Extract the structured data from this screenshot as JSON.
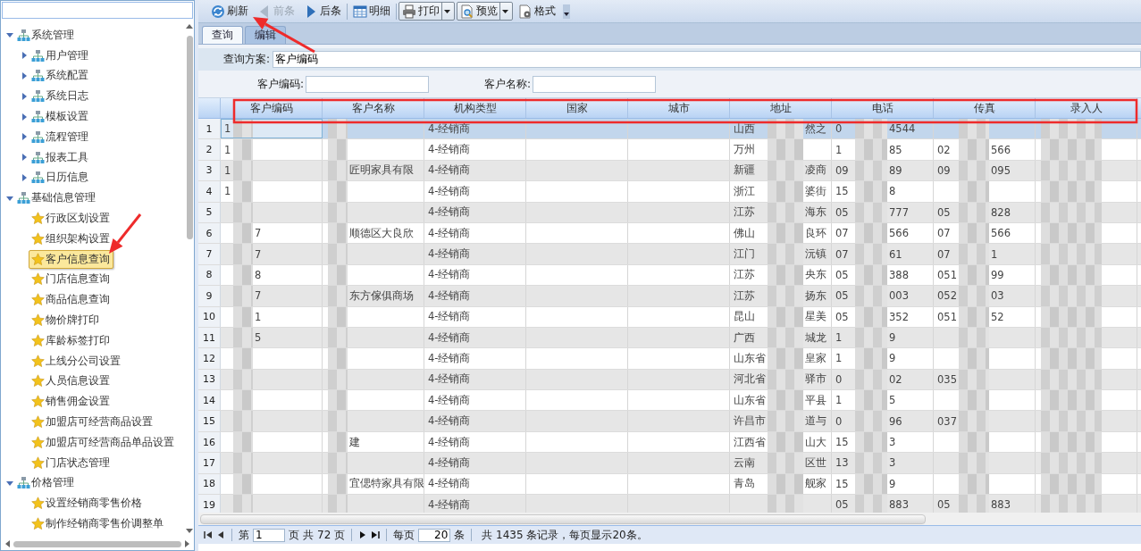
{
  "sidebar": {
    "tree": [
      {
        "label": "系统管理",
        "kind": "group",
        "expanded": true,
        "selected": false,
        "children": [
          {
            "label": "用户管理",
            "kind": "group",
            "expanded": false,
            "selected": false
          },
          {
            "label": "系统配置",
            "kind": "group",
            "expanded": false,
            "selected": false
          },
          {
            "label": "系统日志",
            "kind": "group",
            "expanded": false,
            "selected": false
          },
          {
            "label": "模板设置",
            "kind": "group",
            "expanded": false,
            "selected": false
          },
          {
            "label": "流程管理",
            "kind": "group",
            "expanded": false,
            "selected": false
          },
          {
            "label": "报表工具",
            "kind": "group",
            "expanded": false,
            "selected": false
          },
          {
            "label": "日历信息",
            "kind": "group",
            "expanded": false,
            "selected": false
          }
        ]
      },
      {
        "label": "基础信息管理",
        "kind": "group",
        "expanded": true,
        "selected": false,
        "children": [
          {
            "label": "行政区划设置",
            "kind": "leaf",
            "selected": false
          },
          {
            "label": "组织架构设置",
            "kind": "leaf",
            "selected": false
          },
          {
            "label": "客户信息查询",
            "kind": "leaf",
            "selected": true
          },
          {
            "label": "门店信息查询",
            "kind": "leaf",
            "selected": false
          },
          {
            "label": "商品信息查询",
            "kind": "leaf",
            "selected": false
          },
          {
            "label": "物价牌打印",
            "kind": "leaf",
            "selected": false
          },
          {
            "label": "库龄标签打印",
            "kind": "leaf",
            "selected": false
          },
          {
            "label": "上线分公司设置",
            "kind": "leaf",
            "selected": false
          },
          {
            "label": "人员信息设置",
            "kind": "leaf",
            "selected": false
          },
          {
            "label": "销售佣金设置",
            "kind": "leaf",
            "selected": false
          },
          {
            "label": "加盟店可经营商品设置",
            "kind": "leaf",
            "selected": false
          },
          {
            "label": "加盟店可经营商品单品设置",
            "kind": "leaf",
            "selected": false
          },
          {
            "label": "门店状态管理",
            "kind": "leaf",
            "selected": false
          }
        ]
      },
      {
        "label": "价格管理",
        "kind": "group",
        "expanded": true,
        "selected": false,
        "children": [
          {
            "label": "设置经销商零售价格",
            "kind": "leaf",
            "selected": false
          },
          {
            "label": "制作经销商零售价调整单",
            "kind": "leaf",
            "selected": false
          }
        ]
      }
    ]
  },
  "toolbar": [
    {
      "label": "刷新",
      "kind": "button",
      "disabled": false
    },
    {
      "label": "前条",
      "kind": "button",
      "disabled": true
    },
    {
      "label": "后条",
      "kind": "button",
      "disabled": false
    },
    {
      "label": "明细",
      "kind": "button",
      "disabled": false
    },
    {
      "label": "打印",
      "kind": "split",
      "disabled": false
    },
    {
      "label": "预览",
      "kind": "split",
      "disabled": false
    },
    {
      "label": "格式",
      "kind": "button",
      "disabled": false
    }
  ],
  "tabs": [
    {
      "label": "查询",
      "selected": true
    },
    {
      "label": "编辑",
      "selected": false
    }
  ],
  "query_scheme": {
    "label": "查询方案:",
    "value": "客户编码"
  },
  "filters": [
    {
      "label": "客户编码:"
    },
    {
      "label": "客户名称:"
    }
  ],
  "table": {
    "columns": [
      {
        "label": "客户编码",
        "redacted": true
      },
      {
        "label": "客户名称",
        "redacted": true
      },
      {
        "label": "机构类型"
      },
      {
        "label": "国家"
      },
      {
        "label": "城市"
      },
      {
        "label": "地址",
        "redacted": true
      },
      {
        "label": "电话",
        "redacted": true
      },
      {
        "label": "传真",
        "redacted": true
      },
      {
        "label": "录入人",
        "redacted": true
      }
    ],
    "rows": [
      {
        "number": "1",
        "selected": true,
        "cells": [
          {
            "before": "1"
          },
          null,
          {
            "before": "4-经销商"
          },
          null,
          null,
          {
            "before": "山西",
            "after": "然之"
          },
          {
            "before": "0",
            "after": "4544"
          },
          null,
          null
        ]
      },
      {
        "number": "2",
        "selected": false,
        "cells": [
          {
            "before": "1"
          },
          null,
          {
            "before": "4-经销商"
          },
          null,
          null,
          {
            "before": "万州"
          },
          {
            "before": "1",
            "after": "85"
          },
          {
            "before": "02",
            "after": "566"
          },
          null
        ]
      },
      {
        "number": "3",
        "selected": false,
        "cells": [
          {
            "before": "1"
          },
          {
            "after": "匠明家具有限"
          },
          {
            "before": "4-经销商"
          },
          null,
          null,
          {
            "before": "新疆",
            "after": "凌商"
          },
          {
            "before": "09",
            "after": "89"
          },
          {
            "before": "09",
            "after": "095"
          },
          null
        ]
      },
      {
        "number": "4",
        "selected": false,
        "cells": [
          {
            "before": "1"
          },
          null,
          {
            "before": "4-经销商"
          },
          null,
          null,
          {
            "before": "浙江",
            "after": "婆街"
          },
          {
            "before": "15",
            "after": "8"
          },
          null,
          null
        ]
      },
      {
        "number": "5",
        "selected": false,
        "cells": [
          null,
          null,
          {
            "before": "4-经销商"
          },
          null,
          null,
          {
            "before": "江苏",
            "after": "海东"
          },
          {
            "before": "05",
            "after": "777"
          },
          {
            "before": "05",
            "after": "828"
          },
          null
        ]
      },
      {
        "number": "6",
        "selected": false,
        "cells": [
          {
            "after": "7"
          },
          {
            "after": "顺德区大良欣"
          },
          {
            "before": "4-经销商"
          },
          null,
          null,
          {
            "before": "佛山",
            "after": "良环"
          },
          {
            "before": "07",
            "after": "566"
          },
          {
            "before": "07",
            "after": "566"
          },
          null
        ]
      },
      {
        "number": "7",
        "selected": false,
        "cells": [
          {
            "after": "7"
          },
          null,
          {
            "before": "4-经销商"
          },
          null,
          null,
          {
            "before": "江门",
            "after": "沅镇"
          },
          {
            "before": "07",
            "after": "61"
          },
          {
            "before": "07",
            "after": "1"
          },
          null
        ]
      },
      {
        "number": "8",
        "selected": false,
        "cells": [
          {
            "after": "8"
          },
          null,
          {
            "before": "4-经销商"
          },
          null,
          null,
          {
            "before": "江苏",
            "after": "央东"
          },
          {
            "before": "05",
            "after": "388"
          },
          {
            "before": "051",
            "after": "99"
          },
          null
        ]
      },
      {
        "number": "9",
        "selected": false,
        "cells": [
          {
            "after": "7"
          },
          {
            "after": "东方傢俱商场"
          },
          {
            "before": "4-经销商"
          },
          null,
          null,
          {
            "before": "江苏",
            "after": "扬东"
          },
          {
            "before": "05",
            "after": "003"
          },
          {
            "before": "052",
            "after": "03"
          },
          null
        ]
      },
      {
        "number": "10",
        "selected": false,
        "cells": [
          {
            "after": "1"
          },
          null,
          {
            "before": "4-经销商"
          },
          null,
          null,
          {
            "before": "昆山",
            "after": "星美"
          },
          {
            "before": "05",
            "after": "352"
          },
          {
            "before": "051",
            "after": "52"
          },
          null
        ]
      },
      {
        "number": "11",
        "selected": false,
        "cells": [
          {
            "after": "5"
          },
          null,
          {
            "before": "4-经销商"
          },
          null,
          null,
          {
            "before": "广西",
            "after": "城龙"
          },
          {
            "before": "1",
            "after": "9"
          },
          null,
          null
        ]
      },
      {
        "number": "12",
        "selected": false,
        "cells": [
          null,
          null,
          {
            "before": "4-经销商"
          },
          null,
          null,
          {
            "before": "山东省",
            "after": "皇家"
          },
          {
            "before": "1",
            "after": "9"
          },
          null,
          null
        ]
      },
      {
        "number": "13",
        "selected": false,
        "cells": [
          null,
          null,
          {
            "before": "4-经销商"
          },
          null,
          null,
          {
            "before": "河北省",
            "after": "驿市"
          },
          {
            "before": "0",
            "after": "02"
          },
          {
            "before": "035"
          },
          null
        ]
      },
      {
        "number": "14",
        "selected": false,
        "cells": [
          null,
          null,
          {
            "before": "4-经销商"
          },
          null,
          null,
          {
            "before": "山东省",
            "after": "平县"
          },
          {
            "before": "1",
            "after": "5"
          },
          null,
          null
        ]
      },
      {
        "number": "15",
        "selected": false,
        "cells": [
          null,
          null,
          {
            "before": "4-经销商"
          },
          null,
          null,
          {
            "before": "许昌市",
            "after": "道与"
          },
          {
            "before": "0",
            "after": "96"
          },
          {
            "before": "037"
          },
          null
        ]
      },
      {
        "number": "16",
        "selected": false,
        "cells": [
          null,
          {
            "after": "建"
          },
          {
            "before": "4-经销商"
          },
          null,
          null,
          {
            "before": "江西省",
            "after": "山大"
          },
          {
            "before": "15",
            "after": "3"
          },
          null,
          null
        ]
      },
      {
        "number": "17",
        "selected": false,
        "cells": [
          null,
          null,
          {
            "before": "4-经销商"
          },
          null,
          null,
          {
            "before": "云南",
            "after": "区世"
          },
          {
            "before": "13",
            "after": "3"
          },
          null,
          null
        ]
      },
      {
        "number": "18",
        "selected": false,
        "cells": [
          null,
          {
            "after": "宜偲特家具有限"
          },
          {
            "before": "4-经销商"
          },
          null,
          null,
          {
            "before": "青岛",
            "after": "舰家"
          },
          {
            "before": "15",
            "after": "9"
          },
          null,
          null
        ]
      },
      {
        "number": "19",
        "selected": false,
        "cells": [
          null,
          null,
          {
            "before": "4-经销商"
          },
          null,
          null,
          null,
          {
            "before": "05",
            "after": "883"
          },
          {
            "before": "05",
            "after": "883"
          },
          null
        ]
      }
    ]
  },
  "pager": {
    "page_prefix": "第",
    "page": "1",
    "page_suffix": "页",
    "total_prefix": "共",
    "total_pages": "72",
    "total_suffix": "页",
    "per_page_prefix": "每页",
    "per_page": "20",
    "per_page_suffix": "条",
    "summary": "共 1435 条记录，每页显示20条。"
  },
  "annotations": [
    {
      "kind": "arrow"
    },
    {
      "kind": "arrow"
    },
    {
      "kind": "rectangle"
    }
  ]
}
